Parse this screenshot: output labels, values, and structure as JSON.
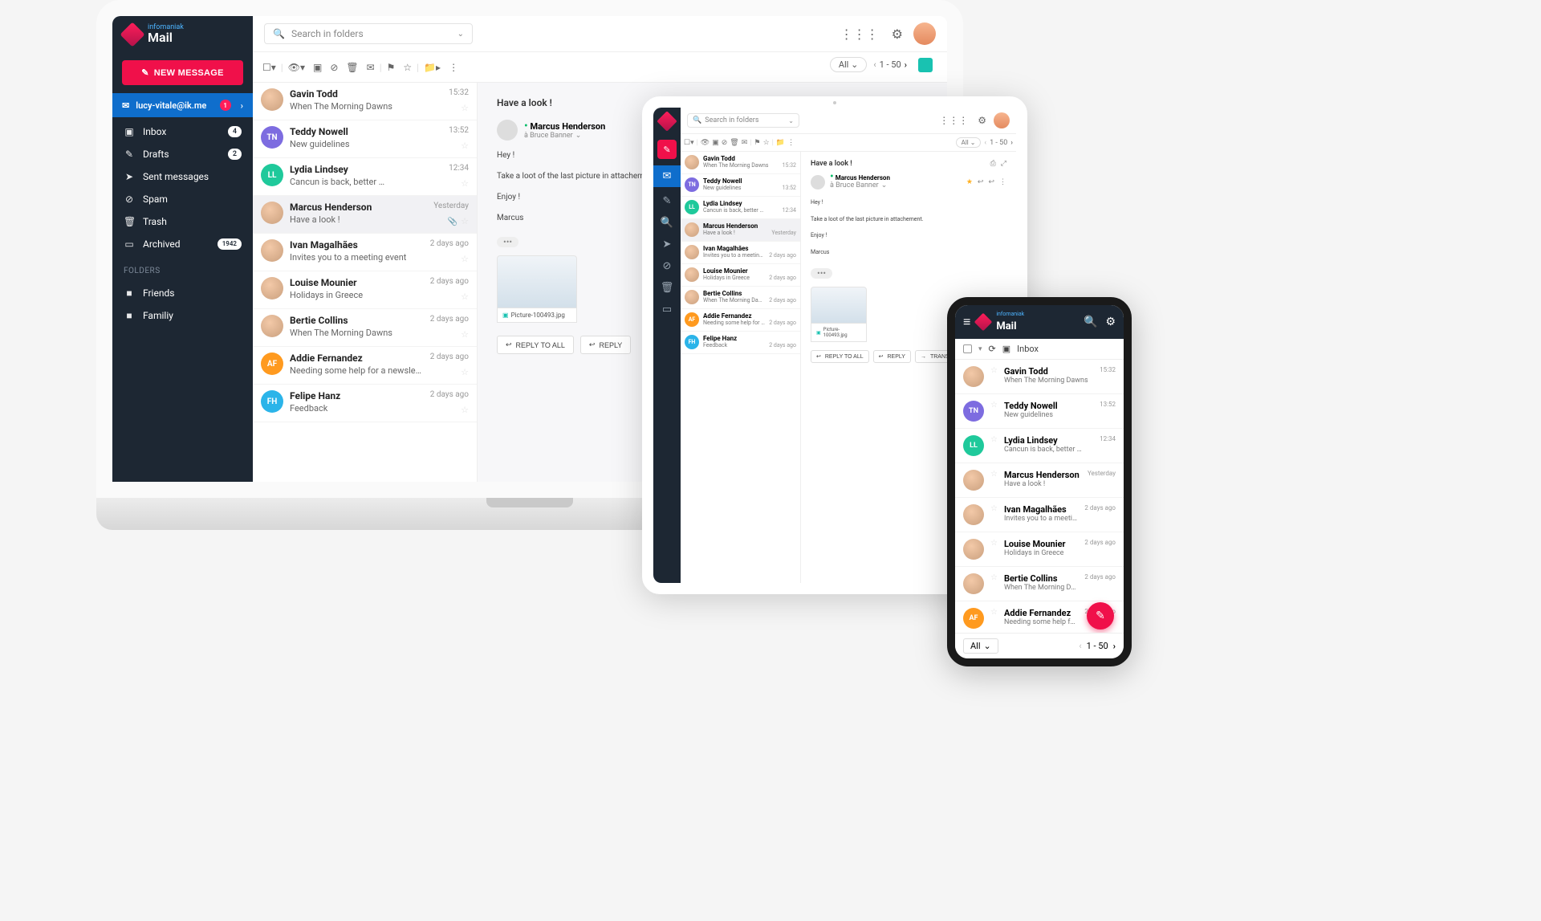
{
  "brand": {
    "company": "infomaniak",
    "product": "Mail"
  },
  "search": {
    "placeholder": "Search in folders"
  },
  "compose_label": "NEW MESSAGE",
  "account": {
    "email": "lucy-vitale@ik.me",
    "badge": "1"
  },
  "nav": {
    "inbox": {
      "label": "Inbox",
      "count": "4"
    },
    "drafts": {
      "label": "Drafts",
      "count": "2"
    },
    "sent": {
      "label": "Sent messages"
    },
    "spam": {
      "label": "Spam"
    },
    "trash": {
      "label": "Trash"
    },
    "archived": {
      "label": "Archived",
      "count": "1942"
    }
  },
  "folders_header": "FOLDERS",
  "folders": {
    "friends": "Friends",
    "family": "Familiy"
  },
  "filter": {
    "all_label": "All"
  },
  "pager": {
    "range": "1 - 50"
  },
  "messages": [
    {
      "name": "Gavin Todd",
      "subject": "When The Morning Dawns",
      "time": "15:32",
      "avatar": "photo",
      "initials": ""
    },
    {
      "name": "Teddy Nowell",
      "subject": "New guidelines",
      "time": "13:52",
      "avatar": "tn",
      "initials": "TN"
    },
    {
      "name": "Lydia Lindsey",
      "subject": "Cancun is back, better …",
      "time": "12:34",
      "avatar": "ll",
      "initials": "LL"
    },
    {
      "name": "Marcus Henderson",
      "subject": "Have a look !",
      "time": "Yesterday",
      "avatar": "photo",
      "initials": "",
      "attach": true,
      "selected": true
    },
    {
      "name": "Ivan Magalhães",
      "subject": "Invites you to a meeting event",
      "time": "2 days ago",
      "avatar": "photo",
      "initials": ""
    },
    {
      "name": "Louise Mounier",
      "subject": "Holidays in Greece",
      "time": "2 days ago",
      "avatar": "photo",
      "initials": ""
    },
    {
      "name": "Bertie Collins",
      "subject": "When The Morning Dawns",
      "time": "2 days ago",
      "avatar": "photo",
      "initials": ""
    },
    {
      "name": "Addie Fernandez",
      "subject": "Needing some help for a newsletter",
      "time": "2 days ago",
      "avatar": "af",
      "initials": "AF"
    },
    {
      "name": "Felipe Hanz",
      "subject": "Feedback",
      "time": "2 days ago",
      "avatar": "fh",
      "initials": "FH"
    }
  ],
  "reader": {
    "subject": "Have a look !",
    "from": "Marcus Henderson",
    "to_label": "à Bruce Banner",
    "body_lines": {
      "l1": "Hey !",
      "l2": "Take a loot of the last picture in attachement.",
      "l3": "Enjoy !",
      "l4": "Marcus"
    },
    "attachment": "Picture-100493.jpg",
    "reply_all": "REPLY TO ALL",
    "reply": "REPLY",
    "transfer": "TRANS..."
  },
  "phone": {
    "inbox_label": "Inbox"
  }
}
